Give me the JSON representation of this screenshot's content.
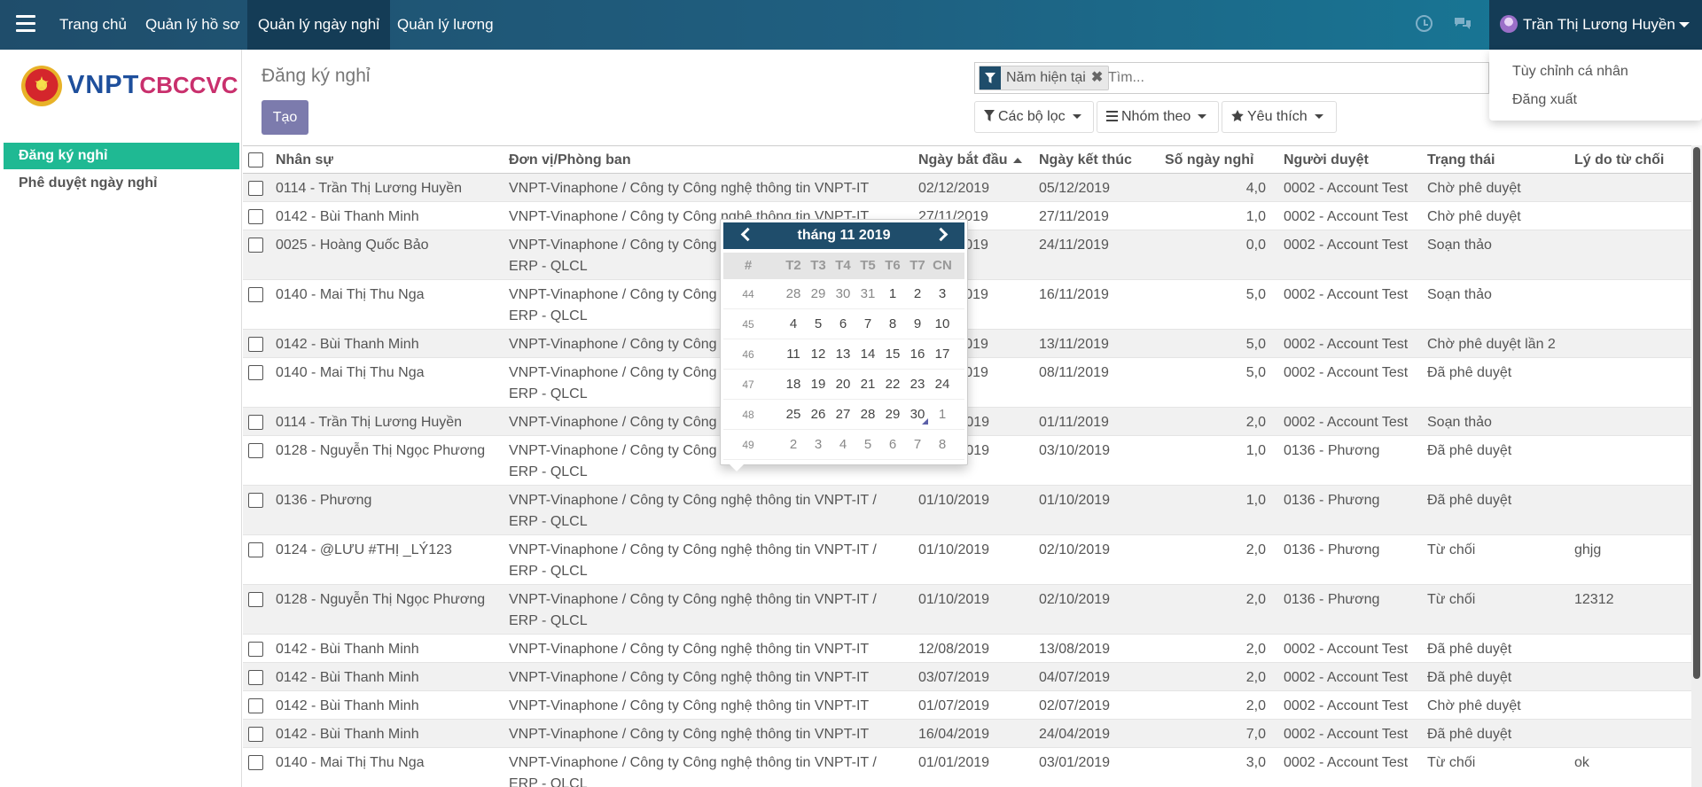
{
  "navbar": {
    "menu": [
      "Trang chủ",
      "Quản lý hồ sơ",
      "Quản lý ngày nghỉ",
      "Quản lý lương"
    ],
    "user_name": "Trần Thị Lương Huyền"
  },
  "user_dropdown": {
    "items": [
      "Tùy chỉnh cá nhân",
      "Đăng xuất"
    ]
  },
  "logo": {
    "brand_main": "VNPT",
    "brand_sub": "CBCCVC"
  },
  "sidebar": {
    "items": [
      "Đăng ký nghỉ",
      "Phê duyệt ngày nghỉ"
    ]
  },
  "control": {
    "title": "Đăng ký nghỉ",
    "create_label": "Tạo",
    "facet": "Năm hiện tại",
    "search_placeholder": "Tìm...",
    "filters_label": "Các bộ lọc",
    "groupby_label": "Nhóm theo",
    "favorites_label": "Yêu thích"
  },
  "table": {
    "headers": [
      "Nhân sự",
      "Đơn vị/Phòng ban",
      "Ngày bắt đầu",
      "Ngày kết thúc",
      "Số ngày nghỉ",
      "Người duyệt",
      "Trạng thái",
      "Lý do từ chối"
    ],
    "rows": [
      {
        "employee": "0114 - Trần Thị Lương Huyền",
        "unit": "VNPT-Vinaphone / Công ty Công nghệ thông tin VNPT-IT",
        "unit2": "",
        "start": "02/12/2019",
        "end": "05/12/2019",
        "days": "4,0",
        "approver": "0002 - Account Test",
        "status": "Chờ phê duyệt",
        "reason": ""
      },
      {
        "employee": "0142 - Bùi Thanh Minh",
        "unit": "VNPT-Vinaphone / Công ty Công nghệ thông tin VNPT-IT",
        "unit2": "",
        "start": "27/11/2019",
        "end": "27/11/2019",
        "days": "1,0",
        "approver": "0002 - Account Test",
        "status": "Chờ phê duyệt",
        "reason": ""
      },
      {
        "employee": "0025 - Hoàng Quốc Bảo",
        "unit": "VNPT-Vinaphone / Công ty Công nghệ thông tin VNPT-IT /",
        "unit2": "ERP - QLCL",
        "start": "24/11/2019",
        "end": "24/11/2019",
        "days": "0,0",
        "approver": "0002 - Account Test",
        "status": "Soạn thảo",
        "reason": ""
      },
      {
        "employee": "0140 - Mai Thị Thu Nga",
        "unit": "VNPT-Vinaphone / Công ty Công nghệ thông tin VNPT-IT /",
        "unit2": "ERP - QLCL",
        "start": "12/11/2019",
        "end": "16/11/2019",
        "days": "5,0",
        "approver": "0002 - Account Test",
        "status": "Soạn thảo",
        "reason": ""
      },
      {
        "employee": "0142 - Bùi Thanh Minh",
        "unit": "VNPT-Vinaphone / Công ty Công nghệ thông tin VNPT-IT",
        "unit2": "",
        "start": "09/11/2019",
        "end": "13/11/2019",
        "days": "5,0",
        "approver": "0002 - Account Test",
        "status": "Chờ phê duyệt lần 2",
        "reason": ""
      },
      {
        "employee": "0140 - Mai Thị Thu Nga",
        "unit": "VNPT-Vinaphone / Công ty Công nghệ thông tin VNPT-IT /",
        "unit2": "ERP - QLCL",
        "start": "04/11/2019",
        "end": "08/11/2019",
        "days": "5,0",
        "approver": "0002 - Account Test",
        "status": "Đã phê duyệt",
        "reason": ""
      },
      {
        "employee": "0114 - Trần Thị Lương Huyền",
        "unit": "VNPT-Vinaphone / Công ty Công nghệ thông tin VNPT-IT",
        "unit2": "",
        "start": "31/10/2019",
        "end": "01/11/2019",
        "days": "2,0",
        "approver": "0002 - Account Test",
        "status": "Soạn thảo",
        "reason": ""
      },
      {
        "employee": "0128 - Nguyễn Thị Ngọc Phương",
        "unit": "VNPT-Vinaphone / Công ty Công nghệ thông tin VNPT-IT /",
        "unit2": "ERP - QLCL",
        "start": "03/10/2019",
        "end": "03/10/2019",
        "days": "1,0",
        "approver": "0136 - Phương",
        "status": "Đã phê duyệt",
        "reason": ""
      },
      {
        "employee": "0136 - Phương",
        "unit": "VNPT-Vinaphone / Công ty Công nghệ thông tin VNPT-IT /",
        "unit2": "ERP - QLCL",
        "start": "01/10/2019",
        "end": "01/10/2019",
        "days": "1,0",
        "approver": "0136 - Phương",
        "status": "Đã phê duyệt",
        "reason": ""
      },
      {
        "employee": "0124 - @LƯU #THỊ _LÝ123",
        "unit": "VNPT-Vinaphone / Công ty Công nghệ thông tin VNPT-IT /",
        "unit2": "ERP - QLCL",
        "start": "01/10/2019",
        "end": "02/10/2019",
        "days": "2,0",
        "approver": "0136 - Phương",
        "status": "Từ chối",
        "reason": "ghjg"
      },
      {
        "employee": "0128 - Nguyễn Thị Ngọc Phương",
        "unit": "VNPT-Vinaphone / Công ty Công nghệ thông tin VNPT-IT /",
        "unit2": "ERP - QLCL",
        "start": "01/10/2019",
        "end": "02/10/2019",
        "days": "2,0",
        "approver": "0136 - Phương",
        "status": "Từ chối",
        "reason": "12312"
      },
      {
        "employee": "0142 - Bùi Thanh Minh",
        "unit": "VNPT-Vinaphone / Công ty Công nghệ thông tin VNPT-IT",
        "unit2": "",
        "start": "12/08/2019",
        "end": "13/08/2019",
        "days": "2,0",
        "approver": "0002 - Account Test",
        "status": "Đã phê duyệt",
        "reason": ""
      },
      {
        "employee": "0142 - Bùi Thanh Minh",
        "unit": "VNPT-Vinaphone / Công ty Công nghệ thông tin VNPT-IT",
        "unit2": "",
        "start": "03/07/2019",
        "end": "04/07/2019",
        "days": "2,0",
        "approver": "0002 - Account Test",
        "status": "Đã phê duyệt",
        "reason": ""
      },
      {
        "employee": "0142 - Bùi Thanh Minh",
        "unit": "VNPT-Vinaphone / Công ty Công nghệ thông tin VNPT-IT",
        "unit2": "",
        "start": "01/07/2019",
        "end": "02/07/2019",
        "days": "2,0",
        "approver": "0002 - Account Test",
        "status": "Chờ phê duyệt",
        "reason": ""
      },
      {
        "employee": "0142 - Bùi Thanh Minh",
        "unit": "VNPT-Vinaphone / Công ty Công nghệ thông tin VNPT-IT",
        "unit2": "",
        "start": "16/04/2019",
        "end": "24/04/2019",
        "days": "7,0",
        "approver": "0002 - Account Test",
        "status": "Đã phê duyệt",
        "reason": ""
      },
      {
        "employee": "0140 - Mai Thị Thu Nga",
        "unit": "VNPT-Vinaphone / Công ty Công nghệ thông tin VNPT-IT /",
        "unit2": "ERP - QLCL",
        "start": "01/01/2019",
        "end": "03/01/2019",
        "days": "3,0",
        "approver": "0002 - Account Test",
        "status": "Từ chối",
        "reason": "ok"
      }
    ]
  },
  "datepicker": {
    "title": "tháng 11 2019",
    "week_col": "#",
    "dow": [
      "T2",
      "T3",
      "T4",
      "T5",
      "T6",
      "T7",
      "CN"
    ],
    "weeks": [
      {
        "no": "44",
        "days": [
          "28",
          "29",
          "30",
          "31",
          "1",
          "2",
          "3"
        ]
      },
      {
        "no": "45",
        "days": [
          "4",
          "5",
          "6",
          "7",
          "8",
          "9",
          "10"
        ]
      },
      {
        "no": "46",
        "days": [
          "11",
          "12",
          "13",
          "14",
          "15",
          "16",
          "17"
        ]
      },
      {
        "no": "47",
        "days": [
          "18",
          "19",
          "20",
          "21",
          "22",
          "23",
          "24"
        ]
      },
      {
        "no": "48",
        "days": [
          "25",
          "26",
          "27",
          "28",
          "29",
          "30",
          "1"
        ]
      },
      {
        "no": "49",
        "days": [
          "2",
          "3",
          "4",
          "5",
          "6",
          "7",
          "8"
        ]
      }
    ],
    "muted_days": [
      [
        0,
        0
      ],
      [
        0,
        1
      ],
      [
        0,
        2
      ],
      [
        0,
        3
      ],
      [
        4,
        6
      ],
      [
        5,
        0
      ],
      [
        5,
        1
      ],
      [
        5,
        2
      ],
      [
        5,
        3
      ],
      [
        5,
        4
      ],
      [
        5,
        5
      ],
      [
        5,
        6
      ]
    ],
    "today": [
      4,
      5
    ]
  }
}
